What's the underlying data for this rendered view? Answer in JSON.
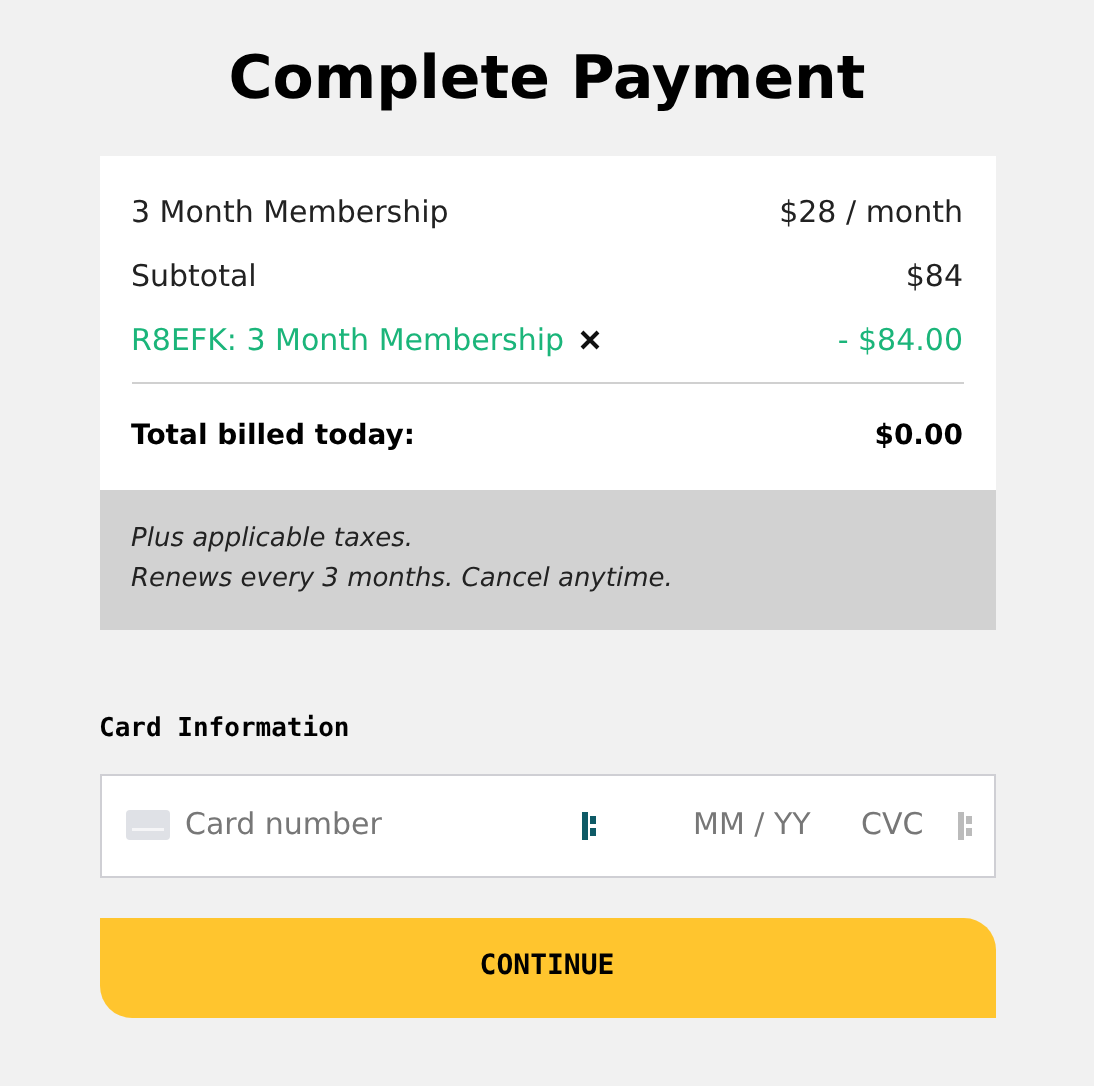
{
  "title": "Complete Payment",
  "summary": {
    "lines": [
      {
        "kind": "item",
        "label": "3 Month Membership",
        "amount": "$28 / month"
      },
      {
        "kind": "item",
        "label": "Subtotal",
        "amount": "$84"
      },
      {
        "kind": "discount",
        "label": "R8EFK: 3 Month Membership",
        "amount": "- $84.00"
      }
    ],
    "total": {
      "label": "Total billed today:",
      "amount": "$0.00"
    },
    "notes": [
      "Plus applicable taxes.",
      "Renews every 3 months. Cancel anytime."
    ]
  },
  "card": {
    "heading": "Card Information",
    "number": {
      "placeholder": "Card number"
    },
    "expiry": {
      "placeholder": "MM / YY"
    },
    "cvc": {
      "placeholder": "CVC"
    }
  },
  "button": "CONTINUE"
}
